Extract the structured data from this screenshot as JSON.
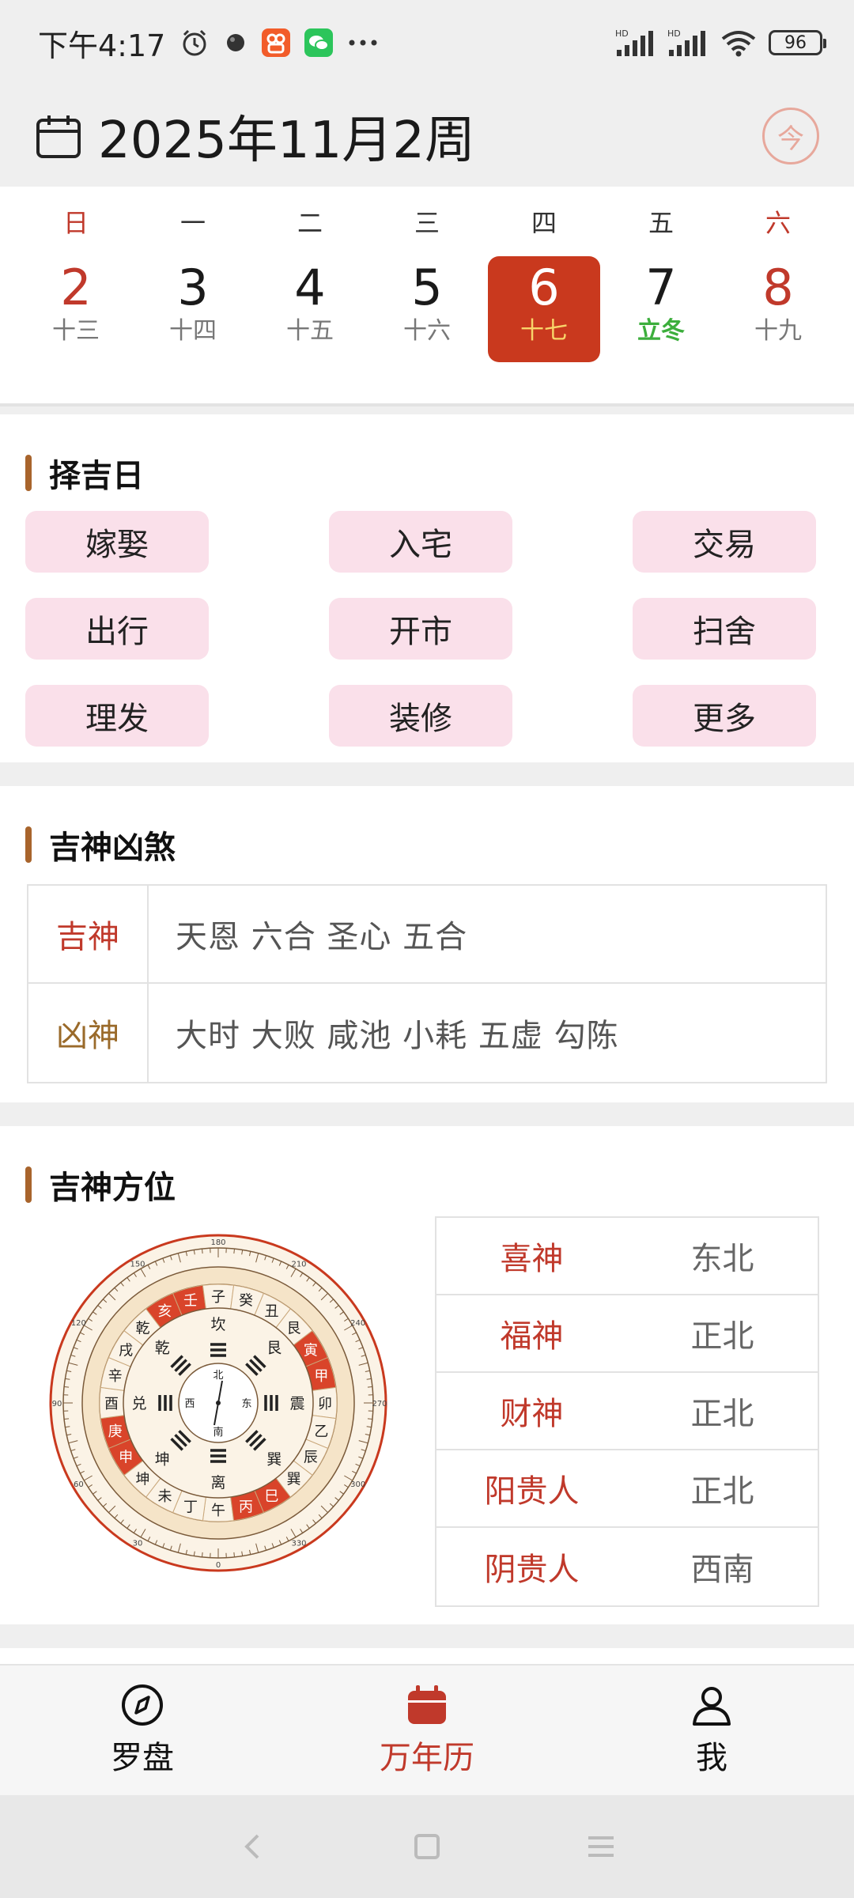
{
  "status": {
    "time": "下午4:17",
    "battery": "96",
    "net1": "HD",
    "net2": "HD"
  },
  "header": {
    "title": "2025年11月2周",
    "today_label": "今"
  },
  "week": {
    "weekdays": [
      "日",
      "一",
      "二",
      "三",
      "四",
      "五",
      "六"
    ],
    "days": [
      {
        "num": "2",
        "lunar": "十三"
      },
      {
        "num": "3",
        "lunar": "十四"
      },
      {
        "num": "4",
        "lunar": "十五"
      },
      {
        "num": "5",
        "lunar": "十六"
      },
      {
        "num": "6",
        "lunar": "十七"
      },
      {
        "num": "7",
        "lunar": "立冬"
      },
      {
        "num": "8",
        "lunar": "十九"
      }
    ]
  },
  "pick_day": {
    "title": "择吉日",
    "items": [
      "嫁娶",
      "入宅",
      "交易",
      "出行",
      "开市",
      "扫舍",
      "理发",
      "装修",
      "更多"
    ]
  },
  "gods": {
    "title": "吉神凶煞",
    "rows": [
      {
        "label": "吉神",
        "values": "天恩 六合 圣心 五合",
        "color": "#c0392b"
      },
      {
        "label": "凶神",
        "values": "大时 大败 咸池 小耗 五虚 勾陈",
        "color": "#9a6a2a"
      }
    ]
  },
  "direction": {
    "title": "吉神方位",
    "rows": [
      {
        "name": "喜神",
        "value": "东北"
      },
      {
        "name": "福神",
        "value": "正北"
      },
      {
        "name": "财神",
        "value": "正北"
      },
      {
        "name": "阳贵人",
        "value": "正北"
      },
      {
        "name": "阴贵人",
        "value": "西南"
      }
    ],
    "compass": {
      "ring_outer": [
        "午",
        "丁",
        "未",
        "坤",
        "申",
        "庚",
        "酉",
        "辛",
        "戌",
        "乾",
        "亥",
        "壬",
        "子",
        "癸",
        "丑",
        "艮",
        "寅",
        "甲",
        "卯",
        "乙",
        "辰",
        "巽",
        "巳",
        "丙"
      ],
      "trigrams": [
        "离",
        "坤",
        "兑",
        "乾",
        "坎",
        "艮",
        "震",
        "巽"
      ],
      "inner": [
        "南",
        "西",
        "北",
        "东"
      ],
      "degree_labels": [
        "0",
        "30",
        "60",
        "90",
        "120",
        "150",
        "180",
        "210",
        "240",
        "270",
        "300",
        "330"
      ]
    }
  },
  "bottom_nav": {
    "items": [
      "罗盘",
      "万年历",
      "我"
    ]
  },
  "colors": {
    "accent": "#c0392b",
    "selected_day": "#c9391e",
    "pick_bg": "#fae0ea",
    "title_bar": "#a8642c"
  }
}
